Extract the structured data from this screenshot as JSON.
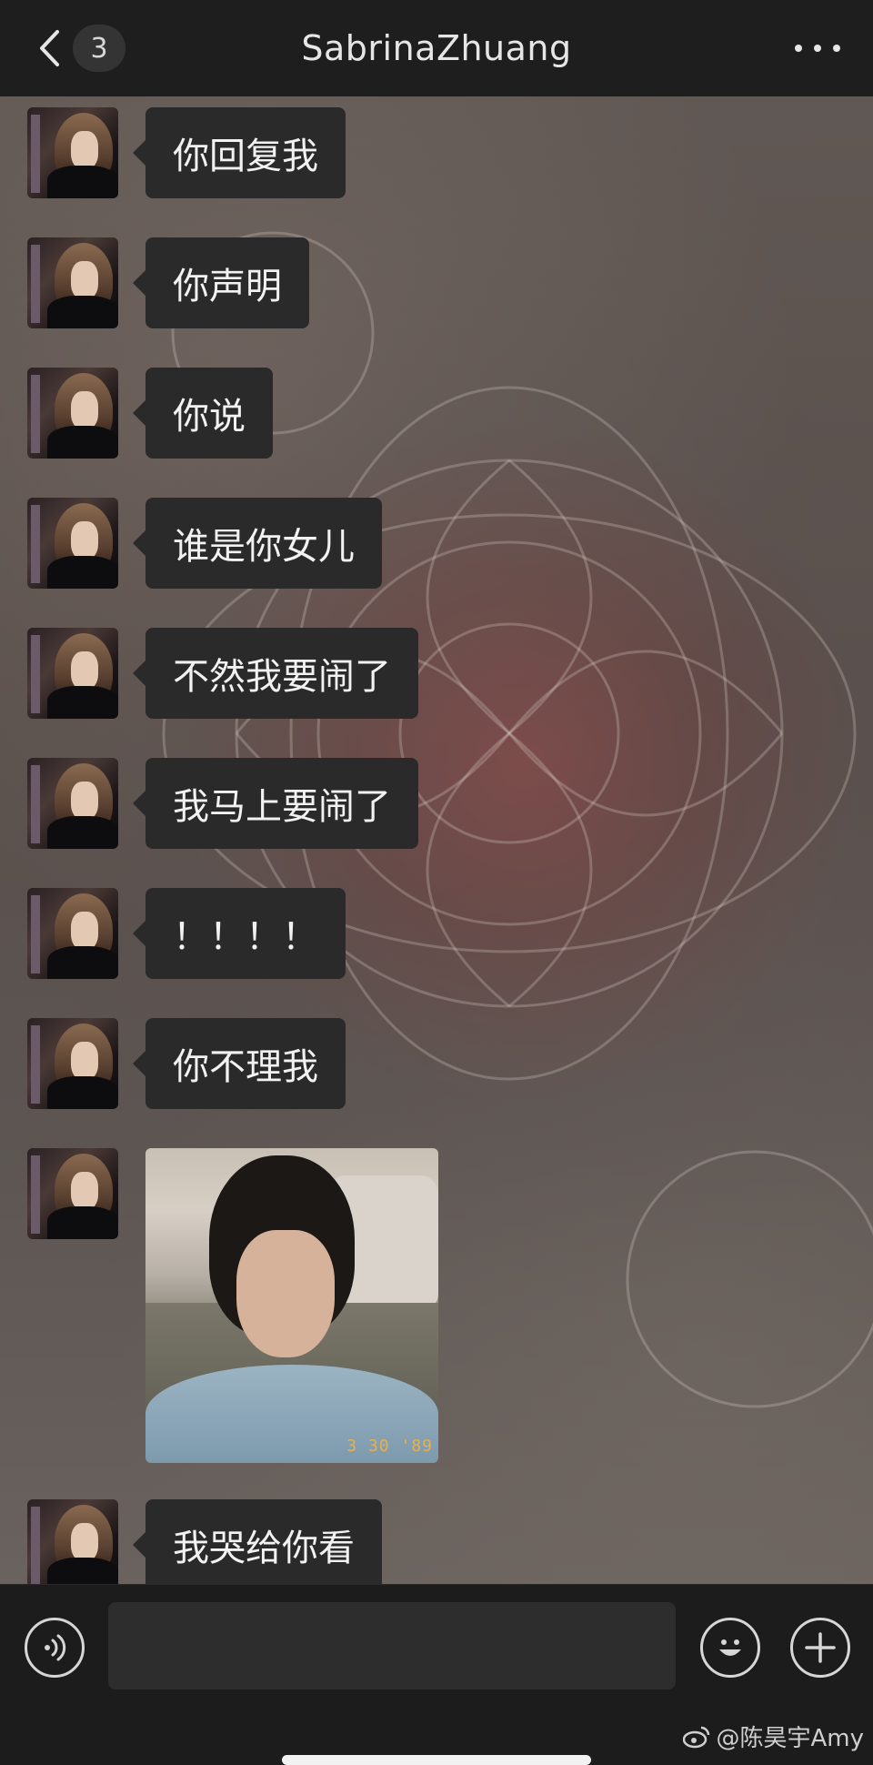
{
  "header": {
    "back_icon": "chevron-left-icon",
    "unread_count": "3",
    "title": "SabrinaZhuang",
    "more_icon": "more-dots-icon"
  },
  "messages": [
    {
      "type": "text",
      "text": "你回复我"
    },
    {
      "type": "text",
      "text": "你声明"
    },
    {
      "type": "text",
      "text": "你说"
    },
    {
      "type": "text",
      "text": "谁是你女儿"
    },
    {
      "type": "text",
      "text": "不然我要闹了"
    },
    {
      "type": "text",
      "text": "我马上要闹了"
    },
    {
      "type": "text",
      "text": "！！！！"
    },
    {
      "type": "text",
      "text": "你不理我"
    },
    {
      "type": "image",
      "date_stamp": "3 30 '89"
    },
    {
      "type": "text",
      "text": "我哭给你看"
    }
  ],
  "input_bar": {
    "voice_icon": "voice-icon",
    "input_value": "",
    "emoji_icon": "emoji-icon",
    "plus_icon": "plus-icon"
  },
  "watermark": "@陈昊宇Amy",
  "colors": {
    "bubble": "#2a2a2a",
    "header": "#1e1e1e",
    "input_bar": "#1c1c1c",
    "date_stamp": "#e9b04a"
  }
}
